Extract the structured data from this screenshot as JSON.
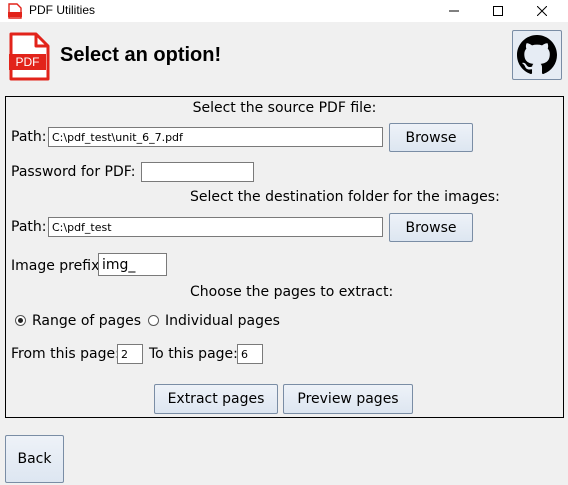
{
  "window": {
    "title": "PDF Utilities"
  },
  "header": {
    "heading": "Select an option!"
  },
  "source": {
    "heading": "Select the source PDF file:",
    "path_label": "Path:",
    "path_value": "C:\\pdf_test\\unit_6_7.pdf",
    "browse_label": "Browse"
  },
  "password": {
    "label": "Password for PDF:",
    "value": ""
  },
  "destination": {
    "heading": "Select the destination folder for the images:",
    "path_label": "Path:",
    "path_value": "C:\\pdf_test",
    "browse_label": "Browse"
  },
  "prefix": {
    "label": "Image prefix:",
    "value": "img_"
  },
  "pages": {
    "heading": "Choose the pages to extract:",
    "range_label": "Range of pages",
    "individual_label": "Individual pages",
    "selected": "range",
    "from_label": "From this page:",
    "from_value": "2",
    "to_label": "To this page:",
    "to_value": "6"
  },
  "actions": {
    "extract_label": "Extract pages",
    "preview_label": "Preview pages",
    "back_label": "Back"
  },
  "colors": {
    "pdf_red": "#e2231a",
    "button_border": "#7a8da5"
  },
  "icons": {
    "app": "pdf-icon",
    "logo": "pdf-file-icon",
    "github": "github-icon"
  }
}
